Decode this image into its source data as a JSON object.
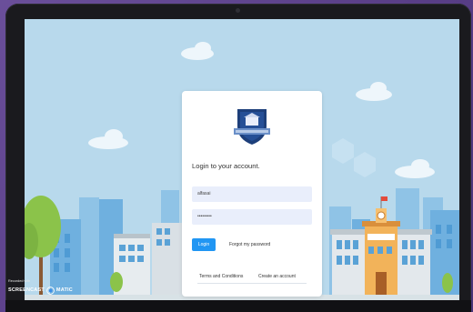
{
  "login": {
    "title": "Login to your account.",
    "username_value": "alfasai",
    "password_value": "•••••••••",
    "login_button": "Login",
    "forgot_link": "Forgot my password",
    "terms_link": "Terms and Conditions",
    "create_link": "Create an account"
  },
  "watermark": {
    "recorded_with": "Recorded with",
    "brand_left": "SCREENCAST",
    "brand_right": "MATIC"
  },
  "colors": {
    "sky": "#b7d8ec",
    "login_button": "#2196f3",
    "input_bg": "#e9eefb",
    "shield": "#1d3f7a",
    "ribbon": "#6a8fc8"
  },
  "icons": [
    "school-crest-logo",
    "screencast-record-icon"
  ]
}
